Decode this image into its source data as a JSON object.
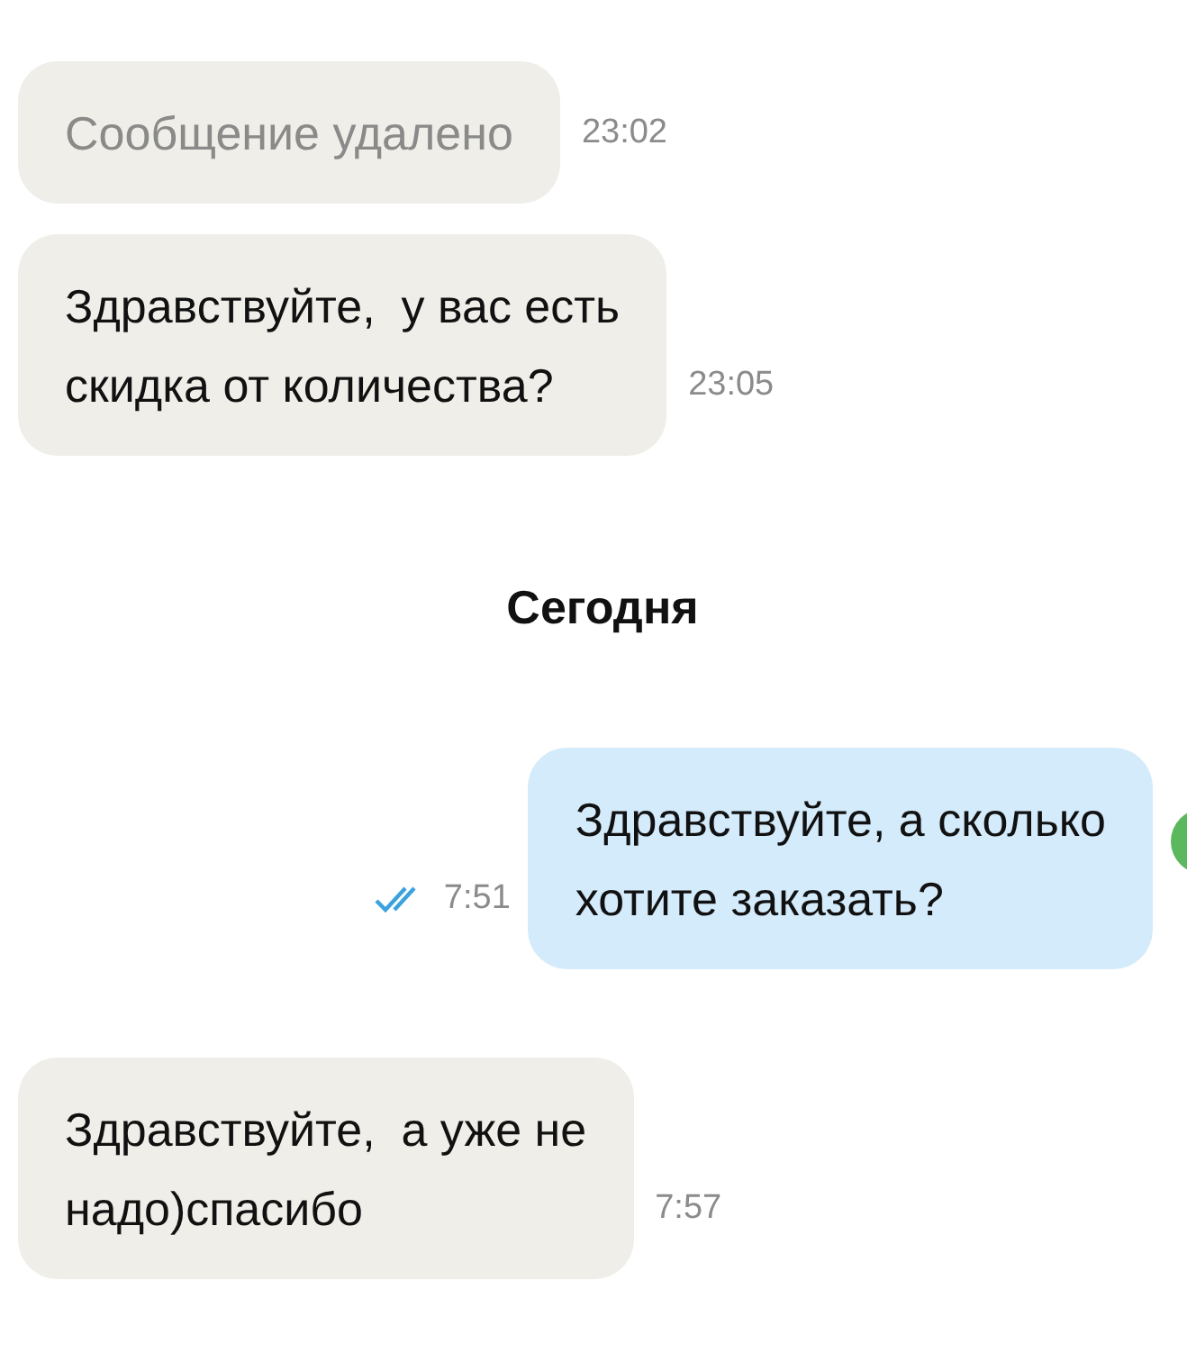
{
  "messages": [
    {
      "kind": "incoming",
      "deleted": true,
      "text": "Сообщение удалено",
      "time": "23:02"
    },
    {
      "kind": "incoming",
      "deleted": false,
      "text": "Здравствуйте,  у вас есть\nскидка от количества?",
      "time": "23:05"
    },
    {
      "kind": "date",
      "text": "Сегодня"
    },
    {
      "kind": "outgoing",
      "read": true,
      "text": "Здравствуйте, а сколько\nхотите заказать?",
      "time": "7:51"
    },
    {
      "kind": "incoming",
      "deleted": false,
      "text": "Здравствуйте,  а уже не\nнадо)спасибо",
      "time": "7:57"
    }
  ]
}
